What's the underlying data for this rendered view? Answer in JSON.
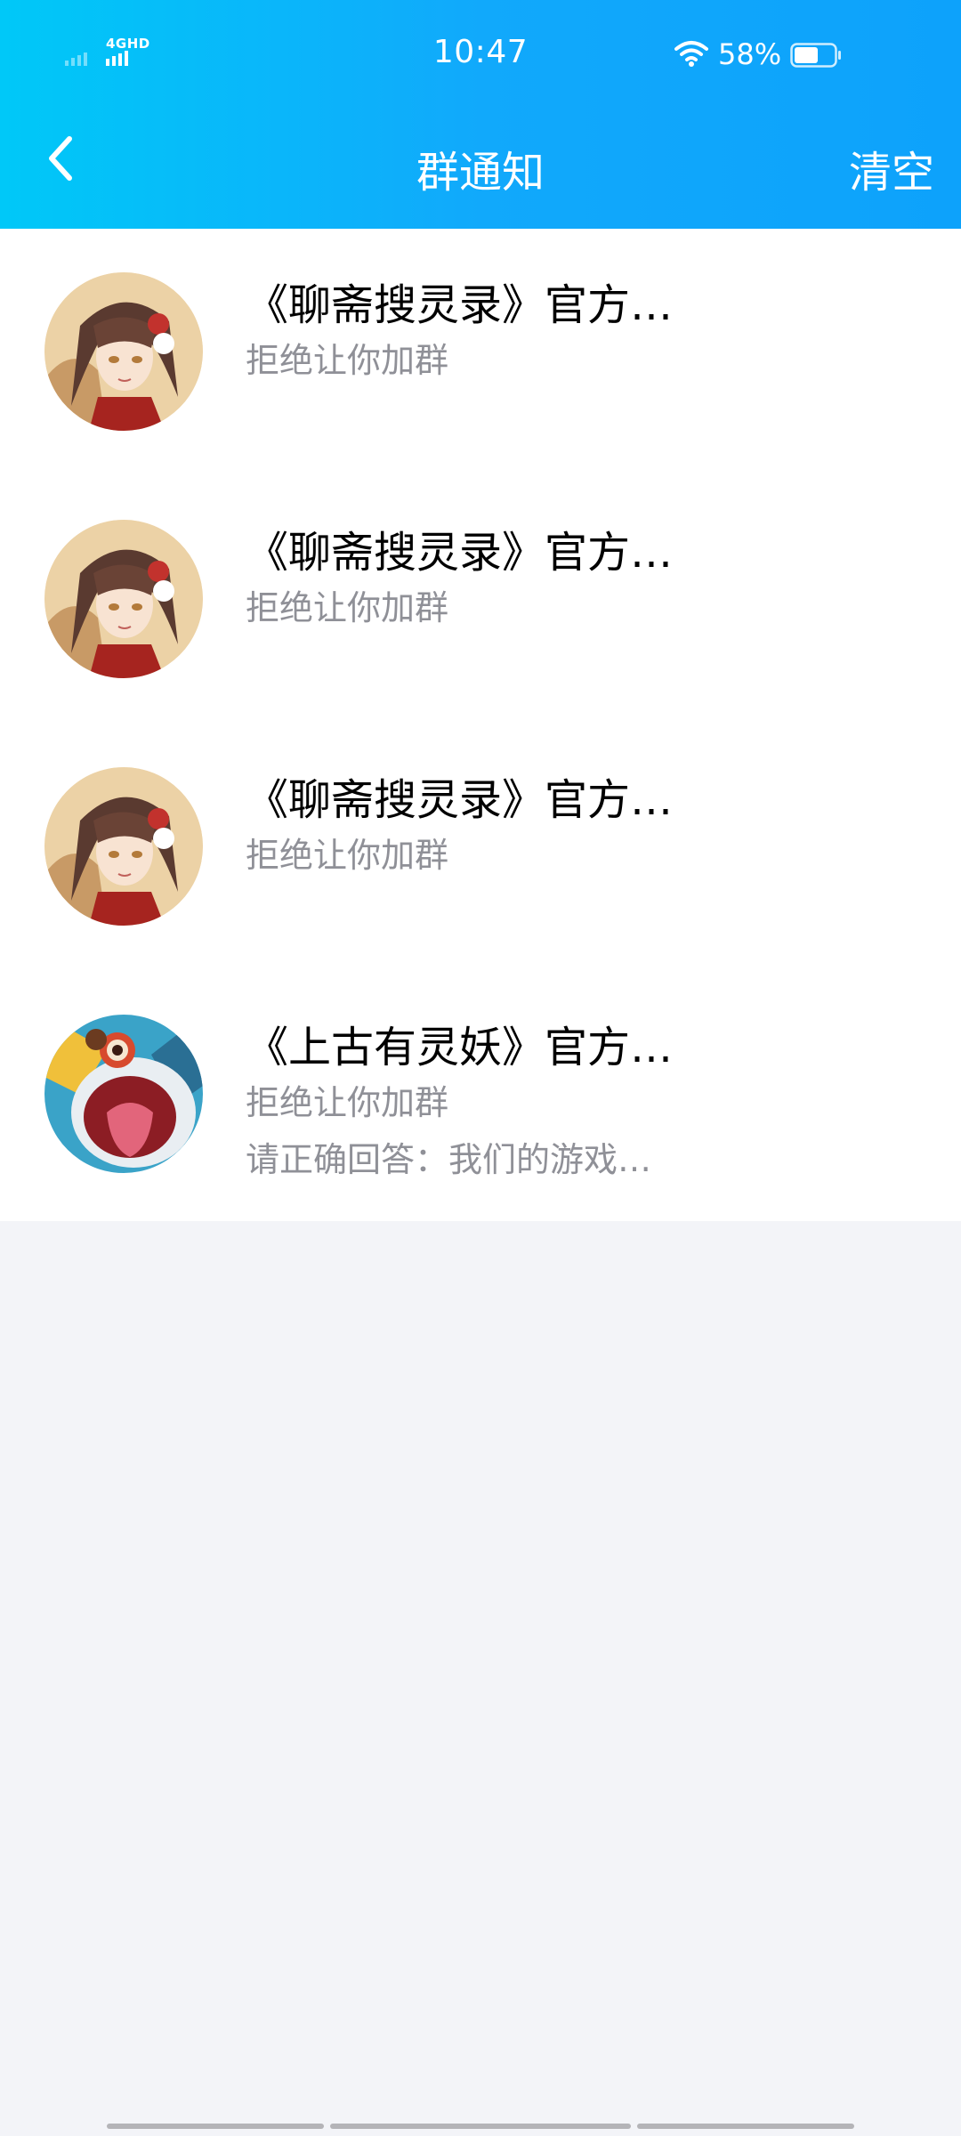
{
  "status_bar": {
    "network": "4GHD",
    "time": "10:47",
    "battery_percent": "58%",
    "battery_level": 0.58
  },
  "nav": {
    "title": "群通知",
    "clear_label": "清空"
  },
  "notifications": [
    {
      "title": "《聊斋搜灵录》官方…",
      "status": "拒绝让你加群",
      "avatar": "girl-avatar"
    },
    {
      "title": "《聊斋搜灵录》官方…",
      "status": "拒绝让你加群",
      "avatar": "girl-avatar"
    },
    {
      "title": "《聊斋搜灵录》官方…",
      "status": "拒绝让你加群",
      "avatar": "girl-avatar"
    },
    {
      "title": "《上古有灵妖》官方…",
      "status": "拒绝让你加群",
      "detail": "请正确回答：我们的游戏…",
      "avatar": "monster-avatar"
    }
  ],
  "colors": {
    "header_gradient_start": "#00c8f8",
    "header_gradient_end": "#0da2fb",
    "page_background": "#f3f4f8",
    "secondary_text": "#8f9097"
  }
}
